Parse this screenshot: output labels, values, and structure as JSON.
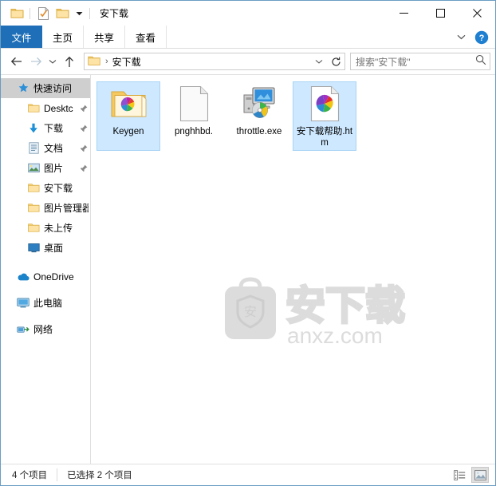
{
  "window": {
    "title": "安下载",
    "quick_access": [
      {
        "name": "folder-icon",
        "label": "folder"
      },
      {
        "name": "properties-icon",
        "label": "properties"
      },
      {
        "name": "new-folder-icon",
        "label": "new folder"
      }
    ],
    "controls": {
      "minimize": "–",
      "maximize": "□",
      "close": "✕"
    }
  },
  "ribbon": {
    "tabs": [
      {
        "label": "文件",
        "active": true
      },
      {
        "label": "主页",
        "active": false
      },
      {
        "label": "共享",
        "active": false
      },
      {
        "label": "查看",
        "active": false
      }
    ],
    "expand_icon": "chevron-down-icon",
    "help_icon": "help-icon",
    "help_glyph": "?"
  },
  "address": {
    "back_glyph": "←",
    "forward_glyph": "→",
    "recent_glyph": "⌄",
    "up_glyph": "↑",
    "separator": "›",
    "crumb": "安下载",
    "dropdown_glyph": "⌄",
    "refresh_glyph": "↻"
  },
  "search": {
    "placeholder": "搜索\"安下载\"",
    "icon": "search-icon"
  },
  "sidebar": {
    "items": [
      {
        "label": "快速访问",
        "icon": "star-pin-icon",
        "level": 0,
        "selected": true,
        "pinned": false
      },
      {
        "label": "Desktc",
        "icon": "folder-icon",
        "level": 1,
        "selected": false,
        "pinned": true
      },
      {
        "label": "下载",
        "icon": "download-icon",
        "level": 1,
        "selected": false,
        "pinned": true
      },
      {
        "label": "文档",
        "icon": "document-icon",
        "level": 1,
        "selected": false,
        "pinned": true
      },
      {
        "label": "图片",
        "icon": "picture-icon",
        "level": 1,
        "selected": false,
        "pinned": true
      },
      {
        "label": "安下载",
        "icon": "folder-icon",
        "level": 1,
        "selected": false,
        "pinned": false
      },
      {
        "label": "图片管理器",
        "icon": "folder-icon",
        "level": 1,
        "selected": false,
        "pinned": false
      },
      {
        "label": "未上传",
        "icon": "folder-icon",
        "level": 1,
        "selected": false,
        "pinned": false
      },
      {
        "label": "桌面",
        "icon": "desktop-icon",
        "level": 1,
        "selected": false,
        "pinned": false
      },
      {
        "label": "OneDrive",
        "icon": "cloud-icon",
        "level": 0,
        "selected": false,
        "pinned": false
      },
      {
        "label": "此电脑",
        "icon": "computer-icon",
        "level": 0,
        "selected": false,
        "pinned": false
      },
      {
        "label": "网络",
        "icon": "network-icon",
        "level": 0,
        "selected": false,
        "pinned": false
      }
    ]
  },
  "files": {
    "items": [
      {
        "label": "Keygen",
        "icon": "folder-pinwheel-icon",
        "selected": true
      },
      {
        "label": "pnghhbd.",
        "icon": "blank-document-icon",
        "selected": false
      },
      {
        "label": "throttle.exe",
        "icon": "application-exe-icon",
        "selected": false
      },
      {
        "label": "安下载帮助.htm",
        "icon": "html-pinwheel-icon",
        "selected": true
      }
    ]
  },
  "watermark": {
    "logo_char": "安",
    "text": "安下载",
    "url": "anxz.com"
  },
  "status": {
    "count": "4 个项目",
    "selected": "已选择 2 个项目",
    "views": [
      {
        "name": "details-view-button",
        "active": false
      },
      {
        "name": "large-icons-view-button",
        "active": true
      }
    ]
  },
  "colors": {
    "accent": "#1e6fb8",
    "selection": "#cde8ff",
    "sidebar_selection": "#cfcfcf",
    "border": "#6a9cc4",
    "folder": "#fcd77f"
  }
}
